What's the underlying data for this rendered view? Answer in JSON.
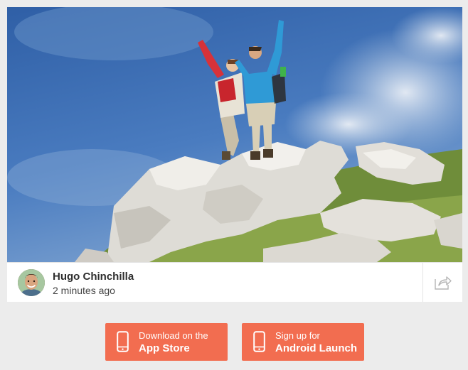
{
  "post": {
    "author_name": "Hugo Chinchilla",
    "timestamp": "2 minutes ago",
    "photo_icon": "hikers-summit-photo",
    "avatar_icon": "user-avatar",
    "share_icon": "share-icon"
  },
  "cta": {
    "appstore": {
      "line1": "Download on the",
      "line2": "App Store",
      "icon": "phone-icon"
    },
    "android": {
      "line1": "Sign up for",
      "line2": "Android Launch",
      "icon": "phone-icon"
    }
  },
  "colors": {
    "accent": "#f26d50",
    "background": "#ececec",
    "card": "#ffffff"
  }
}
